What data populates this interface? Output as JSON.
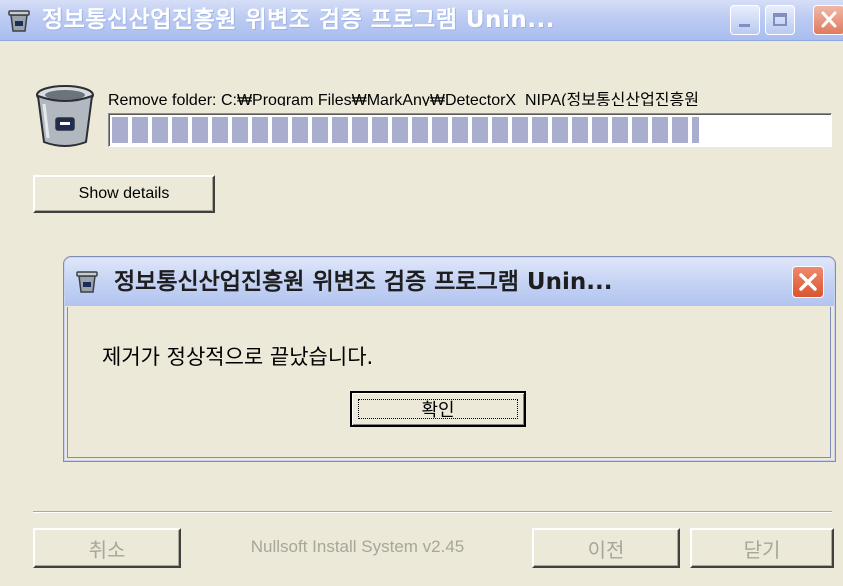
{
  "window": {
    "title": "정보통신산업진흥원 위변조 검증 프로그램 Unin...",
    "controls": {
      "minimize_icon": "minimize-icon",
      "maximize_icon": "maximize-icon",
      "close_icon": "close-icon"
    }
  },
  "status": {
    "label": "Remove folder: C:₩Program Files₩MarkAny₩DetectorX_NIPA(정보통신산업진흥원",
    "progress_percent": 82
  },
  "details_button": "Show details",
  "message_box": {
    "title": "정보통신산업진흥원 위변조 검증 프로그램 Unin...",
    "message": "제거가 정상적으로 끝났습니다.",
    "ok_label": "확인"
  },
  "footer": {
    "cancel_label": "취소",
    "branding": "Nullsoft Install System v2.45",
    "back_label": "이전",
    "close_label": "닫기"
  },
  "colors": {
    "title_gradient_top": "#d6def7",
    "title_gradient_bottom": "#a9bdef",
    "close_red": "#d9542f",
    "progress_block": "#a9aecf",
    "dialog_bg": "#ece9d8"
  }
}
